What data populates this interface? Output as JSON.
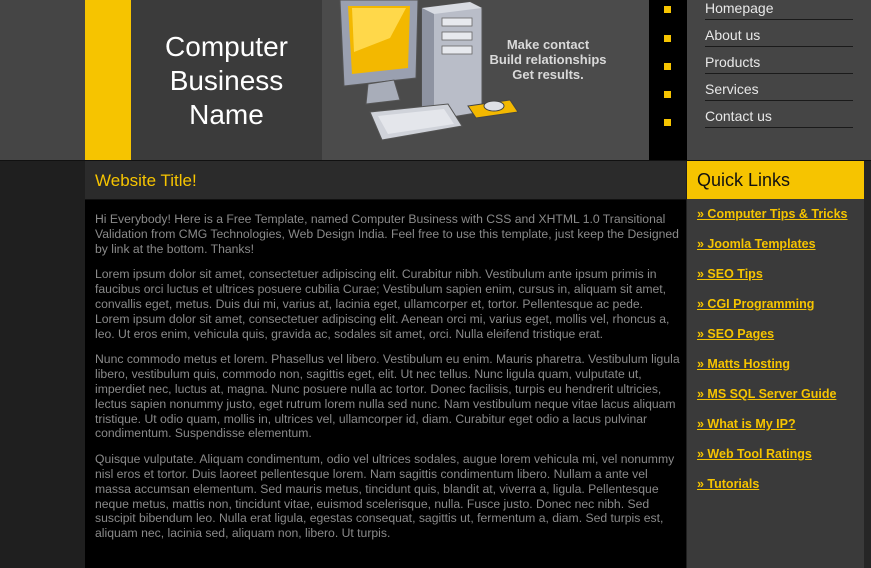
{
  "header": {
    "logo_lines": [
      "Computer",
      "Business",
      "Name"
    ],
    "tagline": [
      "Make contact",
      "Build relationships",
      "Get results."
    ]
  },
  "nav": {
    "items": [
      "Homepage",
      "About us",
      "Products",
      "Services",
      "Contact us"
    ]
  },
  "main": {
    "site_title": "Website Title!",
    "paragraphs": [
      "Hi Everybody! Here is a Free Template, named Computer Business with CSS and XHTML 1.0 Transitional Validation from CMG Technologies, Web Design India. Feel free to use this template, just keep the Designed by link at the bottom. Thanks!",
      "Lorem ipsum dolor sit amet, consectetuer adipiscing elit. Curabitur nibh. Vestibulum ante ipsum primis in faucibus orci luctus et ultrices posuere cubilia Curae; Vestibulum sapien enim, cursus in, aliquam sit amet, convallis eget, metus. Duis dui mi, varius at, lacinia eget, ullamcorper et, tortor. Pellentesque ac pede. Lorem ipsum dolor sit amet, consectetuer adipiscing elit. Aenean orci mi, varius eget, mollis vel, rhoncus a, leo. Ut eros enim, vehicula quis, gravida ac, sodales sit amet, orci. Nulla eleifend tristique erat.",
      "Nunc commodo metus et lorem. Phasellus vel libero. Vestibulum eu enim. Mauris pharetra. Vestibulum ligula libero, vestibulum quis, commodo non, sagittis eget, elit. Ut nec tellus. Nunc ligula quam, vulputate ut, imperdiet nec, luctus at, magna. Nunc posuere nulla ac tortor. Donec facilisis, turpis eu hendrerit ultricies, lectus sapien nonummy justo, eget rutrum lorem nulla sed nunc. Nam vestibulum neque vitae lacus aliquam tristique. Ut odio quam, mollis in, ultrices vel, ullamcorper id, diam. Curabitur eget odio a lacus pulvinar condimentum. Suspendisse elementum.",
      "Quisque vulputate. Aliquam condimentum, odio vel ultrices sodales, augue lorem vehicula mi, vel nonummy nisl eros et tortor. Duis laoreet pellentesque lorem. Nam sagittis condimentum libero. Nullam a ante vel massa accumsan elementum. Sed mauris metus, tincidunt quis, blandit at, viverra a, ligula. Pellentesque neque metus, mattis non, tincidunt vitae, euismod scelerisque, nulla. Fusce justo. Donec nec nibh. Sed suscipit bibendum leo. Nulla erat ligula, egestas consequat, sagittis ut, fermentum a, diam. Sed turpis est, aliquam nec, lacinia sed, aliquam non, libero. Ut turpis."
    ]
  },
  "sidebar": {
    "title": "Quick Links",
    "links": [
      "» Computer Tips & Tricks",
      "» Joomla Templates",
      "» SEO Tips",
      "» CGI Programming",
      "» SEO Pages",
      "» Matts Hosting",
      "» MS SQL Server Guide",
      "» What is My IP?",
      "» Web Tool Ratings",
      "» Tutorials"
    ]
  },
  "colors": {
    "accent": "#f6c400",
    "header_bg": "#454545",
    "content_bg": "#000000",
    "body_text": "#8a8a8a"
  },
  "icons": {
    "illustration": "desktop-computer-icon",
    "nav_bullet": "square-bullet-icon"
  }
}
